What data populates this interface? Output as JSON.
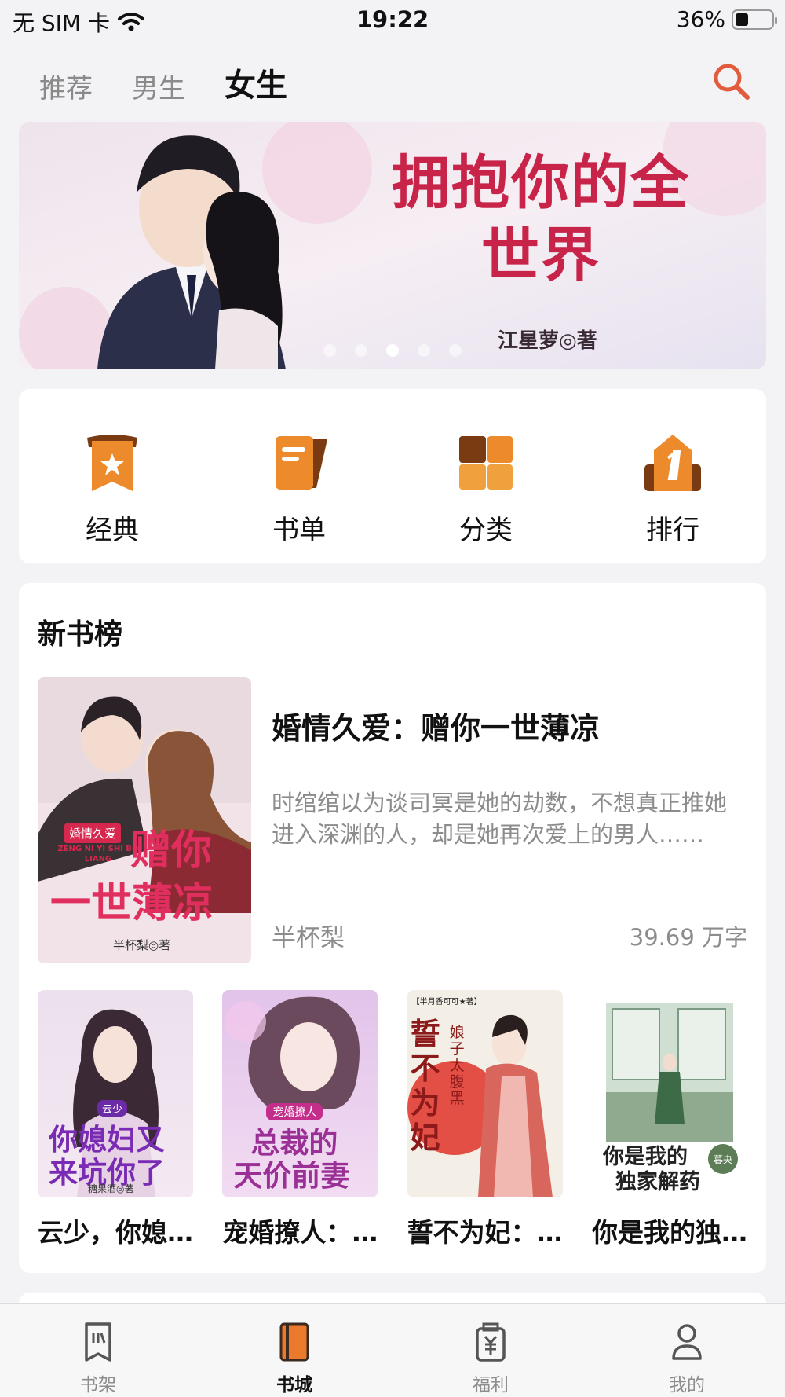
{
  "status_bar": {
    "carrier": "无 SIM 卡",
    "time": "19:22",
    "battery": "36%",
    "battery_level": 0.36
  },
  "top_tabs": [
    {
      "label": "推荐",
      "active": false
    },
    {
      "label": "男生",
      "active": false
    },
    {
      "label": "女生",
      "active": true
    }
  ],
  "banner": {
    "title": "拥抱你的全世界",
    "byline": "江星萝◎著",
    "slide_count": 5,
    "active_slide": 2
  },
  "quick_links": [
    {
      "label": "经典",
      "icon": "bookmark-star-icon"
    },
    {
      "label": "书单",
      "icon": "booklist-icon"
    },
    {
      "label": "分类",
      "icon": "category-grid-icon"
    },
    {
      "label": "排行",
      "icon": "rank-one-icon"
    }
  ],
  "new_books": {
    "section_title": "新书榜",
    "featured": {
      "title": "婚情久爱：赠你一世薄凉",
      "description": "时绾绾以为谈司冥是她的劫数，不想真正推她进入深渊的人，却是她再次爱上的男人……",
      "author": "半杯梨",
      "word_count": "39.69 万字",
      "cover": {
        "line1": "赠你",
        "line2": "一世薄凉",
        "tag": "婚情久爱",
        "pinyin": "ZENG NI YI SHI BO LIANG",
        "author": "半杯梨◎著"
      }
    },
    "books": [
      {
        "title": "云少，你媳妇又来坑你了",
        "cover": {
          "line1": "你媳妇又",
          "line2": "来坑你了",
          "tag": "云少",
          "author": "糖果酒◎著"
        }
      },
      {
        "title": "宠婚撩人：总裁的天价前妻",
        "cover": {
          "line1": "总裁的",
          "line2": "天价前妻",
          "tag": "宠婚撩人"
        }
      },
      {
        "title": "誓不为妃：娘子太腹黑",
        "cover": {
          "line1": "誓不为妃",
          "tag": "娘子太腹黑",
          "author": "【半月香可可★著】"
        }
      },
      {
        "title": "你是我的独家解药",
        "cover": {
          "line1": "你是我的",
          "line2": "独家解药",
          "author": "暮央"
        }
      }
    ]
  },
  "bottom_nav": [
    {
      "label": "书架",
      "icon": "bookshelf-icon",
      "active": false
    },
    {
      "label": "书城",
      "icon": "bookstore-icon",
      "active": true
    },
    {
      "label": "福利",
      "icon": "bonus-icon",
      "active": false
    },
    {
      "label": "我的",
      "icon": "profile-icon",
      "active": false
    }
  ],
  "colors": {
    "accent": "#e25b3c",
    "icon_orange": "#ec8a2c",
    "icon_dark": "#7a3a12",
    "text_secondary": "#8c8c8c",
    "background": "#f3f3f5"
  }
}
